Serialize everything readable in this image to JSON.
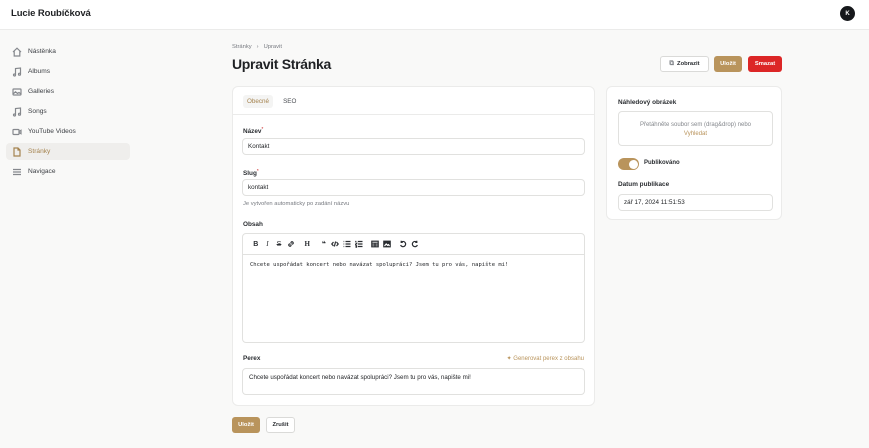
{
  "app": {
    "title": "Lucie Roubíčková",
    "avatar_initial": "K"
  },
  "sidebar": {
    "items": [
      {
        "label": "Nástěnka",
        "icon": "home-icon",
        "active": false
      },
      {
        "label": "Albums",
        "icon": "music-note-icon",
        "active": false
      },
      {
        "label": "Galleries",
        "icon": "image-icon",
        "active": false
      },
      {
        "label": "Songs",
        "icon": "music-note-icon",
        "active": false
      },
      {
        "label": "YouTube Videos",
        "icon": "video-icon",
        "active": false
      },
      {
        "label": "Stránky",
        "icon": "document-icon",
        "active": true
      },
      {
        "label": "Navigace",
        "icon": "menu-icon",
        "active": false
      }
    ]
  },
  "header": {
    "breadcrumb": [
      "Stránky",
      "Upravit"
    ],
    "title": "Upravit Stránka",
    "view_label": "Zobrazit",
    "save_label": "Uložit",
    "delete_label": "Smazat"
  },
  "form": {
    "tabs": [
      {
        "label": "Obecné",
        "active": true
      },
      {
        "label": "SEO",
        "active": false
      }
    ],
    "name_label": "Název",
    "name_value": "Kontakt",
    "slug_label": "Slug",
    "slug_value": "kontakt",
    "slug_help": "Je vytvořen automaticky po zadání názvu",
    "content_label": "Obsah",
    "content_text": "Chcete uspořádat koncert nebo navázat spolupráci? Jsem tu pro vás, napište mi!",
    "perex_label": "Perex",
    "perex_generate": "Generovat perex z obsahu",
    "perex_value": "Chcete uspořádat koncert nebo navázat spolupráci? Jsem tu pro vás, napište mi!",
    "toolbar": {
      "bold": "B",
      "italic": "I",
      "strike": "S",
      "heading": "H",
      "quote": "❝"
    }
  },
  "side": {
    "preview_label": "Náhledový obrázek",
    "drop_text": "Přetáhněte soubor sem (drag&drop) nebo",
    "drop_link": "Vyhledat",
    "published_label": "Publikováno",
    "published": true,
    "date_label": "Datum publikace",
    "date_value": "zář 17, 2024 11:51:53"
  },
  "footer": {
    "save_label": "Uložit",
    "cancel_label": "Zrušit"
  },
  "colors": {
    "accent": "#b9945c",
    "danger": "#dc2626",
    "text": "#1f2124"
  }
}
